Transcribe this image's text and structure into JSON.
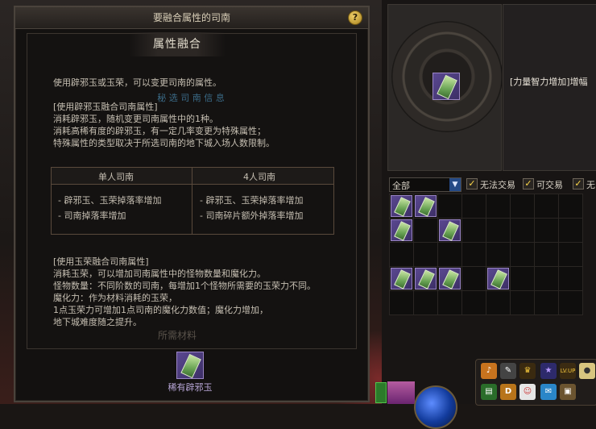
{
  "dialog": {
    "title": "要融合属性的司南",
    "help": "?",
    "section_title": "属性融合",
    "ghost_label": "秘 选 司 南 信 息",
    "intro": "使用辟邪玉或玉荣，可以变更司南的属性。",
    "bixie_block": [
      "[使用辟邪玉融合司南属性]",
      "消耗辟邪玉，随机变更司南属性中的1种。",
      "消耗高稀有度的辟邪玉，有一定几率变更为特殊属性；",
      "特殊属性的类型取决于所选司南的地下城入场人数限制。"
    ],
    "table": {
      "headers": [
        "单人司南",
        "4人司南"
      ],
      "col1": [
        "- 辟邪玉、玉荣掉落率增加",
        "- 司南掉落率增加"
      ],
      "col2": [
        "- 辟邪玉、玉荣掉落率增加",
        "- 司南碎片额外掉落率增加"
      ]
    },
    "yurong_block": [
      "[使用玉荣融合司南属性]",
      "消耗玉荣，可以增加司南属性中的怪物数量和魔化力。",
      "怪物数量：不同阶数的司南，每增加1个怪物所需要的玉荣力不同。",
      "魔化力：作为材料消耗的玉荣，",
      "1点玉荣力可增加1点司南的魔化力数值；魔化力增加，",
      "地下城难度随之提升。"
    ],
    "materials_title": "所需材料",
    "material_name": "稀有辟邪玉"
  },
  "inventory": {
    "seal_description": "[力量智力增加]增幅",
    "filter_select": "全部",
    "filters": [
      "无法交易",
      "可交易",
      "无"
    ],
    "items_rows": [
      [
        1,
        1,
        0,
        0,
        0,
        0,
        0,
        0
      ],
      [
        1,
        0,
        1,
        0,
        0,
        0,
        0,
        0
      ],
      [
        0,
        0,
        0,
        0,
        0,
        0,
        0,
        0
      ],
      [
        1,
        1,
        1,
        0,
        1,
        0,
        0,
        0
      ],
      [
        0,
        0,
        0,
        0,
        0,
        0,
        0,
        0
      ]
    ]
  },
  "hotbar": {
    "items": [
      "quest-icon",
      "book-icon",
      "crown-icon",
      "star-icon",
      "lvup-icon",
      "egg-icon"
    ],
    "lvup_label": "LV.UP",
    "row2": [
      "cards-icon",
      "d-icon",
      "pet-icon",
      "chat-icon",
      "bag-icon"
    ],
    "d_label": "D"
  },
  "colors": {
    "gem_green": "#6aa455",
    "gem_frame": "#5a4890",
    "accent_gold": "#f3d26a",
    "select_blue": "#254a86"
  }
}
